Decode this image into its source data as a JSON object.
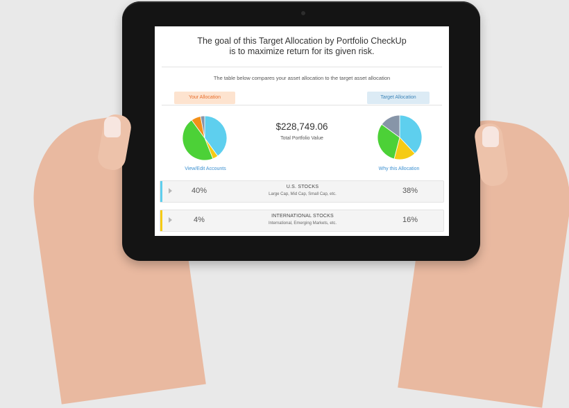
{
  "goal_title": {
    "line1": "The goal of this Target Allocation by Portfolio CheckUp",
    "line2": "is to maximize return for its given risk."
  },
  "subtitle": "The table below compares your asset allocation to the target asset allocation",
  "tabs": {
    "your_allocation": "Your Allocation",
    "target_allocation": "Target Allocation"
  },
  "total": {
    "value": "$228,749.06",
    "label": "Total Portfolio Value"
  },
  "links": {
    "view_edit": "View/Edit Accounts",
    "why": "Why this Allocation"
  },
  "colors": {
    "us_stocks": "#5ecfee",
    "intl_stocks": "#f5cb14",
    "bonds": "#4cd137",
    "other_orange": "#f39019",
    "other_slate": "#8795a8",
    "tag_yours_text": "#e86e2c",
    "tag_target_text": "#3c84b8",
    "link": "#3a8fd0"
  },
  "rows": [
    {
      "left_pct": "40%",
      "name": "U.S. STOCKS",
      "desc": "Large Cap, Mid Cap, Small Cap, etc.",
      "right_pct": "38%",
      "color": "#5ecfee"
    },
    {
      "left_pct": "4%",
      "name": "INTERNATIONAL STOCKS",
      "desc": "International, Emerging Markets, etc.",
      "right_pct": "16%",
      "color": "#f5cb14"
    }
  ],
  "chart_data": [
    {
      "type": "pie",
      "title": "Your Allocation",
      "slices": [
        {
          "value": 40,
          "color": "#5ecfee"
        },
        {
          "value": 4,
          "color": "#f5cb14"
        },
        {
          "value": 46,
          "color": "#4cd137"
        },
        {
          "value": 7,
          "color": "#f39019"
        },
        {
          "value": 3,
          "color": "#8795a8"
        }
      ]
    },
    {
      "type": "pie",
      "title": "Target Allocation",
      "slices": [
        {
          "value": 38,
          "color": "#5ecfee"
        },
        {
          "value": 16,
          "color": "#f5cb14"
        },
        {
          "value": 31,
          "color": "#4cd137"
        },
        {
          "value": 15,
          "color": "#8795a8"
        }
      ]
    }
  ]
}
